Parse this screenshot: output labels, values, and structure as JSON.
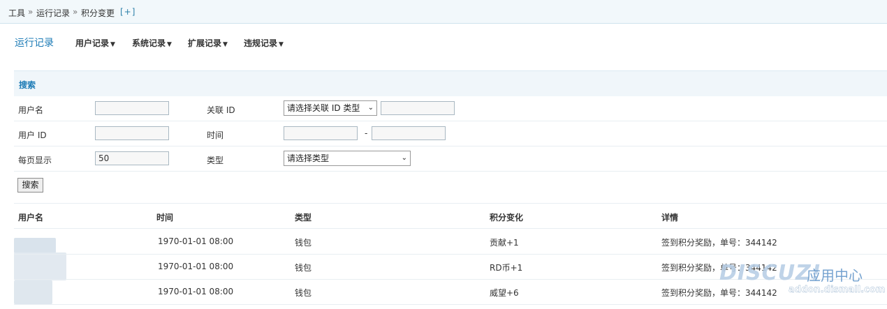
{
  "breadcrumb": {
    "items": [
      "工具",
      "运行记录",
      "积分变更"
    ],
    "sep": "»",
    "plus": "[+]"
  },
  "nav": {
    "title": "运行记录",
    "items": [
      {
        "label": "用户记录"
      },
      {
        "label": "系统记录"
      },
      {
        "label": "扩展记录"
      },
      {
        "label": "违规记录"
      }
    ],
    "caret": "▼"
  },
  "search": {
    "heading": "搜索",
    "username_label": "用户名",
    "relid_label": "关联 ID",
    "relid_type_select": "请选择关联 ID 类型",
    "userid_label": "用户 ID",
    "time_label": "时间",
    "time_sep": "-",
    "perpage_label": "每页显示",
    "perpage_value": "50",
    "type_label": "类型",
    "type_select": "请选择类型",
    "submit": "搜索"
  },
  "table": {
    "columns": [
      "用户名",
      "时间",
      "类型",
      "积分变化",
      "详情"
    ],
    "rows": [
      {
        "time": "1970-01-01 08:00",
        "type": "钱包",
        "change": "贡献+1",
        "detail": "签到积分奖励，单号：344142"
      },
      {
        "time": "1970-01-01 08:00",
        "type": "钱包",
        "change": "RD币+1",
        "detail": "签到积分奖励，单号：344142"
      },
      {
        "time": "1970-01-01 08:00",
        "type": "钱包",
        "change": "威望+6",
        "detail": "签到积分奖励，单号：344142"
      }
    ]
  },
  "watermark": {
    "logo": "DISCUZ!",
    "cn": "应用中心",
    "url": "addon.dismall.com"
  },
  "colors": {
    "accent": "#1c7bb6",
    "panel": "#f0f6fa"
  }
}
